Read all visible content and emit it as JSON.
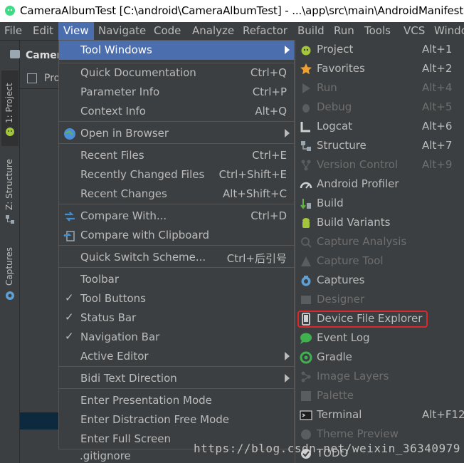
{
  "window": {
    "title": "CameraAlbumTest [C:\\android\\CameraAlbumTest] - ...\\app\\src\\main\\AndroidManifest."
  },
  "menubar": {
    "items": [
      "File",
      "Edit",
      "View",
      "Navigate",
      "Code",
      "Analyze",
      "Refactor",
      "Build",
      "Run",
      "Tools",
      "VCS",
      "Windo"
    ]
  },
  "toolwindows": {
    "project": "1: Project",
    "structure": "Z: Structure",
    "captures": "Captures"
  },
  "project_panel": {
    "header": "Camer",
    "tab": "Pro",
    "file": ".gitignore"
  },
  "view_menu": {
    "items": [
      {
        "label": "Tool Windows",
        "shortcut": "",
        "submenu": true
      },
      {
        "label": "Quick Documentation",
        "shortcut": "Ctrl+Q"
      },
      {
        "label": "Parameter Info",
        "shortcut": "Ctrl+P"
      },
      {
        "label": "Context Info",
        "shortcut": "Alt+Q"
      },
      {
        "label": "Open in Browser",
        "shortcut": "",
        "submenu": true
      },
      {
        "label": "Recent Files",
        "shortcut": "Ctrl+E"
      },
      {
        "label": "Recently Changed Files",
        "shortcut": "Ctrl+Shift+E"
      },
      {
        "label": "Recent Changes",
        "shortcut": "Alt+Shift+C"
      },
      {
        "label": "Compare With...",
        "shortcut": "Ctrl+D"
      },
      {
        "label": "Compare with Clipboard",
        "shortcut": ""
      },
      {
        "label": "Quick Switch Scheme...",
        "shortcut": "Ctrl+后引号"
      },
      {
        "label": "Toolbar",
        "shortcut": ""
      },
      {
        "label": "Tool Buttons",
        "shortcut": "",
        "checked": true
      },
      {
        "label": "Status Bar",
        "shortcut": "",
        "checked": true
      },
      {
        "label": "Navigation Bar",
        "shortcut": "",
        "checked": true
      },
      {
        "label": "Active Editor",
        "shortcut": "",
        "submenu": true
      },
      {
        "label": "Bidi Text Direction",
        "shortcut": "",
        "submenu": true
      },
      {
        "label": "Enter Presentation Mode",
        "shortcut": ""
      },
      {
        "label": "Enter Distraction Free Mode",
        "shortcut": ""
      },
      {
        "label": "Enter Full Screen",
        "shortcut": ""
      }
    ]
  },
  "tool_windows_submenu": {
    "items": [
      {
        "label": "Project",
        "shortcut": "Alt+1",
        "enabled": true,
        "icon": "android-icon"
      },
      {
        "label": "Favorites",
        "shortcut": "Alt+2",
        "enabled": true,
        "icon": "star-icon"
      },
      {
        "label": "Run",
        "shortcut": "Alt+4",
        "enabled": false,
        "icon": "play-icon"
      },
      {
        "label": "Debug",
        "shortcut": "Alt+5",
        "enabled": false,
        "icon": "bug-icon"
      },
      {
        "label": "Logcat",
        "shortcut": "Alt+6",
        "enabled": true,
        "icon": "logcat-icon"
      },
      {
        "label": "Structure",
        "shortcut": "Alt+7",
        "enabled": true,
        "icon": "structure-icon"
      },
      {
        "label": "Version Control",
        "shortcut": "Alt+9",
        "enabled": false,
        "icon": "vcs-icon"
      },
      {
        "label": "Android Profiler",
        "shortcut": "",
        "enabled": true,
        "icon": "profiler-icon"
      },
      {
        "label": "Build",
        "shortcut": "",
        "enabled": true,
        "icon": "build-icon"
      },
      {
        "label": "Build Variants",
        "shortcut": "",
        "enabled": true,
        "icon": "android-icon"
      },
      {
        "label": "Capture Analysis",
        "shortcut": "",
        "enabled": false,
        "icon": "magnifier-icon"
      },
      {
        "label": "Capture Tool",
        "shortcut": "",
        "enabled": false,
        "icon": "triangle-icon"
      },
      {
        "label": "Captures",
        "shortcut": "",
        "enabled": true,
        "icon": "camera-icon"
      },
      {
        "label": "Designer",
        "shortcut": "",
        "enabled": false,
        "icon": "designer-icon"
      },
      {
        "label": "Device File Explorer",
        "shortcut": "",
        "enabled": true,
        "icon": "phone-icon"
      },
      {
        "label": "Event Log",
        "shortcut": "",
        "enabled": true,
        "icon": "speech-bubble-icon"
      },
      {
        "label": "Gradle",
        "shortcut": "",
        "enabled": true,
        "icon": "gradle-icon"
      },
      {
        "label": "Image Layers",
        "shortcut": "",
        "enabled": false,
        "icon": "layers-icon"
      },
      {
        "label": "Palette",
        "shortcut": "",
        "enabled": false,
        "icon": "palette-icon"
      },
      {
        "label": "Terminal",
        "shortcut": "Alt+F12",
        "enabled": true,
        "icon": "terminal-icon"
      },
      {
        "label": "Theme Preview",
        "shortcut": "",
        "enabled": false,
        "icon": "theme-icon"
      },
      {
        "label": "TODO",
        "shortcut": "",
        "enabled": true,
        "icon": "todo-icon"
      }
    ]
  },
  "watermark": "https://blog.csdn.net/weixin_36340979",
  "colors": {
    "highlight": "#4b6eaf",
    "annotation": "#e0262b"
  }
}
